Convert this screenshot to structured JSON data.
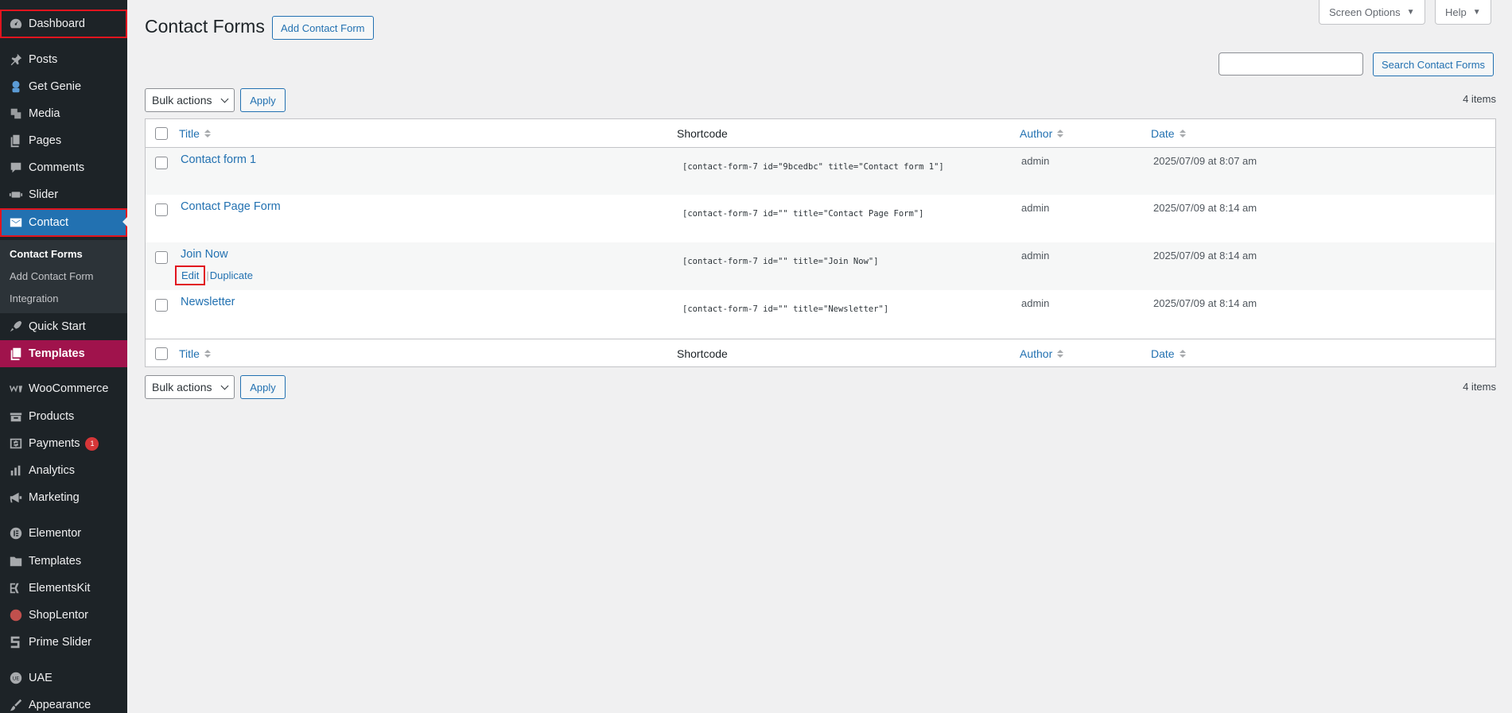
{
  "sidebar": {
    "items": [
      {
        "label": "Dashboard",
        "icon": "dashboard-icon"
      },
      {
        "label": "Posts",
        "icon": "pin-icon"
      },
      {
        "label": "Get Genie",
        "icon": "genie-icon"
      },
      {
        "label": "Media",
        "icon": "media-icon"
      },
      {
        "label": "Pages",
        "icon": "pages-icon"
      },
      {
        "label": "Comments",
        "icon": "comments-icon"
      },
      {
        "label": "Slider",
        "icon": "slider-icon"
      },
      {
        "label": "Contact",
        "icon": "mail-icon"
      },
      {
        "label": "Quick Start",
        "icon": "rocket-icon"
      },
      {
        "label": "Templates",
        "icon": "templates-icon"
      },
      {
        "label": "WooCommerce",
        "icon": "woo-icon"
      },
      {
        "label": "Products",
        "icon": "products-icon"
      },
      {
        "label": "Payments",
        "icon": "payments-icon",
        "badge": "1"
      },
      {
        "label": "Analytics",
        "icon": "analytics-icon"
      },
      {
        "label": "Marketing",
        "icon": "megaphone-icon"
      },
      {
        "label": "Elementor",
        "icon": "elementor-icon"
      },
      {
        "label": "Templates",
        "icon": "folder-icon"
      },
      {
        "label": "ElementsKit",
        "icon": "elementskit-icon"
      },
      {
        "label": "ShopLentor",
        "icon": "shoplentor-icon"
      },
      {
        "label": "Prime Slider",
        "icon": "prime-slider-icon"
      },
      {
        "label": "UAE",
        "icon": "uae-icon"
      },
      {
        "label": "Appearance",
        "icon": "brush-icon"
      }
    ],
    "submenu": [
      "Contact Forms",
      "Add Contact Form",
      "Integration"
    ]
  },
  "header": {
    "title": "Contact Forms",
    "add_button": "Add Contact Form",
    "screen_options": "Screen Options",
    "help": "Help",
    "search_button": "Search Contact Forms",
    "search_value": ""
  },
  "bulk": {
    "select": "Bulk actions",
    "apply": "Apply",
    "count": "4 items"
  },
  "table": {
    "columns": {
      "title": "Title",
      "shortcode": "Shortcode",
      "author": "Author",
      "date": "Date"
    },
    "rows": [
      {
        "title": "Contact form 1",
        "shortcode": "[contact-form-7 id=\"9bcedbc\" title=\"Contact form 1\"]",
        "author": "admin",
        "date": "2025/07/09 at 8:07 am"
      },
      {
        "title": "Contact Page Form",
        "shortcode": "[contact-form-7 id=\"\" title=\"Contact Page Form\"]",
        "author": "admin",
        "date": "2025/07/09 at 8:14 am"
      },
      {
        "title": "Join Now",
        "shortcode": "[contact-form-7 id=\"\" title=\"Join Now\"]",
        "author": "admin",
        "date": "2025/07/09 at 8:14 am"
      },
      {
        "title": "Newsletter",
        "shortcode": "[contact-form-7 id=\"\" title=\"Newsletter\"]",
        "author": "admin",
        "date": "2025/07/09 at 8:14 am"
      }
    ],
    "row_actions": {
      "edit": "Edit",
      "separator": "|",
      "duplicate": "Duplicate"
    }
  },
  "colors": {
    "sidebar_bg": "#1d2327",
    "accent": "#2271b1",
    "templates_highlight": "#a0134c",
    "annotation_red": "#e1141e"
  }
}
